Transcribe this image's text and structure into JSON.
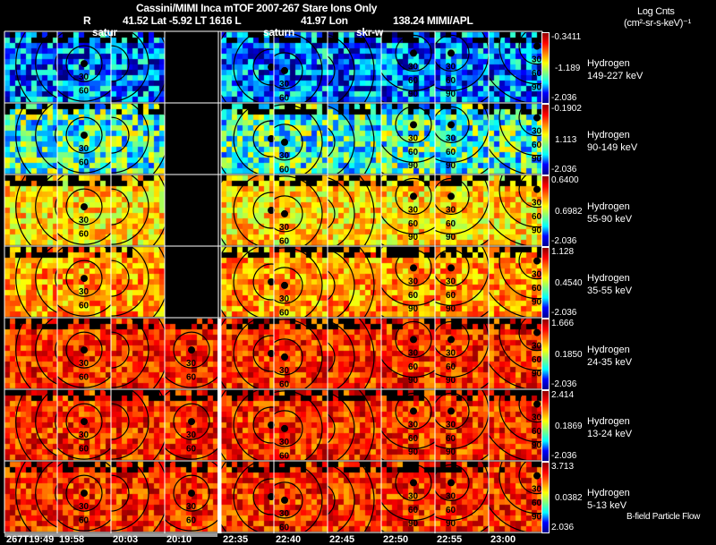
{
  "header": {
    "title": "Cassini/MIMI Inca mTOF  2007-267    Stare    Ions Only",
    "r_label": "R",
    "position_line": "41.52 Lat -5.92 LT 1616 L",
    "lon_line": "41.97 Lon",
    "lon_value": "138.24  MIMI/APL",
    "units_title": "Log Cnts",
    "units": "(cm²-sr-s-keV)⁻¹"
  },
  "overlay_labels": [
    "satur",
    "saturn",
    "skr-w"
  ],
  "footer_note": "B-field Particle Flow",
  "chart_data": {
    "type": "heatmap",
    "colormap": "jet",
    "time_labels": [
      "267T19:49",
      "19:58",
      "20:03",
      "20:10",
      "22:35",
      "22:40",
      "22:45",
      "22:50",
      "22:55",
      "23:00"
    ],
    "contour_labels": [
      "30",
      "60",
      "90",
      "120",
      "150",
      "180"
    ],
    "rows": [
      {
        "species": "Hydrogen",
        "energy": "149-227 keV",
        "cbar_max": "-0.3411",
        "cbar_mid": "-1.189",
        "cbar_min": "-2.036"
      },
      {
        "species": "Hydrogen",
        "energy": "90-149 keV",
        "cbar_max": "-0.1902",
        "cbar_mid": "1.113",
        "cbar_min": "-2.036"
      },
      {
        "species": "Hydrogen",
        "energy": "55-90 keV",
        "cbar_max": "0.6400",
        "cbar_mid": "0.6982",
        "cbar_min": "-2.036"
      },
      {
        "species": "Hydrogen",
        "energy": "35-55 keV",
        "cbar_max": "1.128",
        "cbar_mid": "0.4540",
        "cbar_min": "-2.036"
      },
      {
        "species": "Hydrogen",
        "energy": "24-35 keV",
        "cbar_max": "1.666",
        "cbar_mid": "0.1850",
        "cbar_min": "-2.036"
      },
      {
        "species": "Hydrogen",
        "energy": "13-24 keV",
        "cbar_max": "2.414",
        "cbar_mid": "0.1869",
        "cbar_min": "-2.036"
      },
      {
        "species": "Hydrogen",
        "energy": "5-13 keV",
        "cbar_max": "3.713",
        "cbar_mid": "0.0382",
        "cbar_min": "2.036"
      }
    ]
  }
}
